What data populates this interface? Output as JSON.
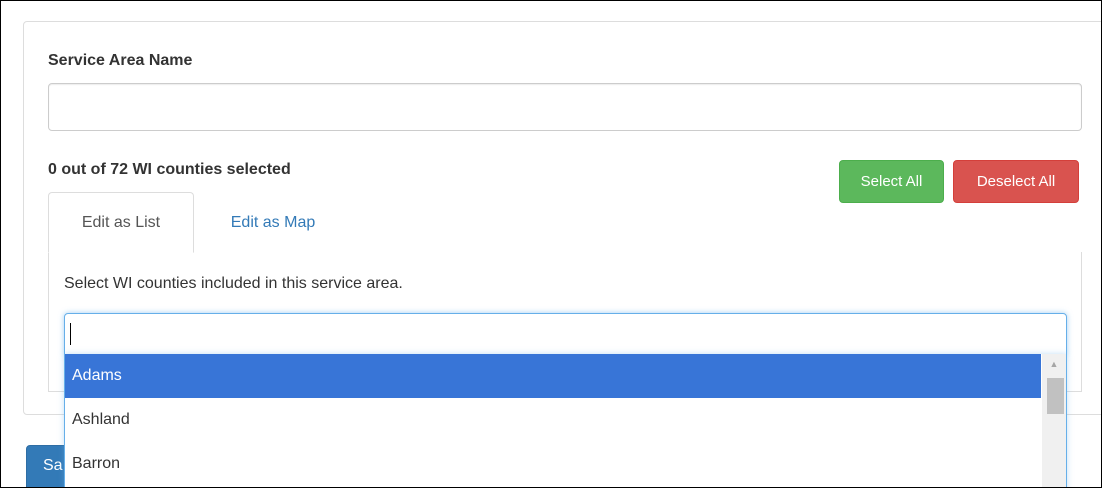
{
  "form": {
    "service_area_label": "Service Area Name",
    "service_area_value": "",
    "service_area_placeholder": ""
  },
  "selection": {
    "count_text": "0 out of 72 WI counties selected",
    "select_all_label": "Select All",
    "deselect_all_label": "Deselect All"
  },
  "tabs": [
    {
      "label": "Edit as List",
      "active": true
    },
    {
      "label": "Edit as Map",
      "active": false
    }
  ],
  "list_panel": {
    "help_text": "Select WI counties included in this service area.",
    "search_value": ""
  },
  "dropdown": {
    "options": [
      {
        "label": "Adams",
        "highlighted": true
      },
      {
        "label": "Ashland",
        "highlighted": false
      },
      {
        "label": "Barron",
        "highlighted": false
      }
    ]
  },
  "footer": {
    "save_label_visible": "Sa"
  },
  "colors": {
    "primary": "#337ab7",
    "success": "#5cb85c",
    "danger": "#d9534f",
    "highlight": "#3875d7",
    "focus_border": "#66afe9"
  }
}
